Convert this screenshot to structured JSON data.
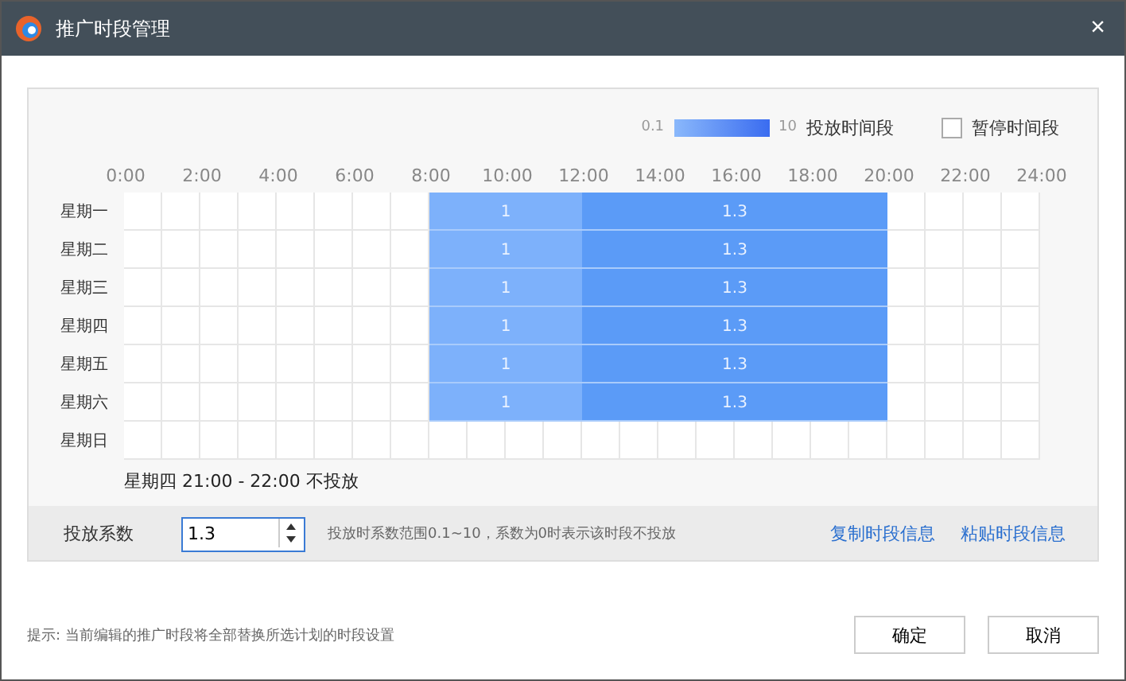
{
  "window": {
    "title": "推广时段管理",
    "close": "×"
  },
  "legend": {
    "min": "0.1",
    "max": "10",
    "label": "投放时间段",
    "pause": {
      "label": "暂停时间段",
      "checked": false
    }
  },
  "hours": [
    "0:00",
    "2:00",
    "4:00",
    "6:00",
    "8:00",
    "10:00",
    "12:00",
    "14:00",
    "16:00",
    "18:00",
    "20:00",
    "22:00",
    "24:00"
  ],
  "schedule": [
    {
      "day": "星期一",
      "values": [
        "1",
        "1.3"
      ],
      "cells": [
        {
          "active": false
        },
        {
          "active": false
        },
        {
          "active": false
        },
        {
          "active": false
        },
        {
          "active": false
        },
        {
          "active": false
        },
        {
          "active": false
        },
        {
          "active": false
        },
        {
          "active": true,
          "color": "#7db1fb"
        },
        {
          "active": true,
          "color": "#7db1fb"
        },
        {
          "active": true,
          "color": "#7db1fb"
        },
        {
          "active": true,
          "color": "#7db1fb"
        },
        {
          "active": true,
          "color": "#5b9bf7"
        },
        {
          "active": true,
          "color": "#5b9bf7"
        },
        {
          "active": true,
          "color": "#5b9bf7"
        },
        {
          "active": true,
          "color": "#5b9bf7"
        },
        {
          "active": true,
          "color": "#5b9bf7"
        },
        {
          "active": true,
          "color": "#5b9bf7"
        },
        {
          "active": true,
          "color": "#5b9bf7"
        },
        {
          "active": true,
          "color": "#5b9bf7"
        },
        {
          "active": false
        },
        {
          "active": false
        },
        {
          "active": false
        },
        {
          "active": false
        }
      ]
    },
    {
      "day": "星期二",
      "values": [
        "1",
        "1.3"
      ],
      "cells": [
        {
          "active": false
        },
        {
          "active": false
        },
        {
          "active": false
        },
        {
          "active": false
        },
        {
          "active": false
        },
        {
          "active": false
        },
        {
          "active": false
        },
        {
          "active": false
        },
        {
          "active": true,
          "color": "#7db1fb"
        },
        {
          "active": true,
          "color": "#7db1fb"
        },
        {
          "active": true,
          "color": "#7db1fb"
        },
        {
          "active": true,
          "color": "#7db1fb"
        },
        {
          "active": true,
          "color": "#5b9bf7"
        },
        {
          "active": true,
          "color": "#5b9bf7"
        },
        {
          "active": true,
          "color": "#5b9bf7"
        },
        {
          "active": true,
          "color": "#5b9bf7"
        },
        {
          "active": true,
          "color": "#5b9bf7"
        },
        {
          "active": true,
          "color": "#5b9bf7"
        },
        {
          "active": true,
          "color": "#5b9bf7"
        },
        {
          "active": true,
          "color": "#5b9bf7"
        },
        {
          "active": false
        },
        {
          "active": false
        },
        {
          "active": false
        },
        {
          "active": false
        }
      ]
    },
    {
      "day": "星期三",
      "values": [
        "1",
        "1.3"
      ],
      "cells": [
        {
          "active": false
        },
        {
          "active": false
        },
        {
          "active": false
        },
        {
          "active": false
        },
        {
          "active": false
        },
        {
          "active": false
        },
        {
          "active": false
        },
        {
          "active": false
        },
        {
          "active": true,
          "color": "#7db1fb"
        },
        {
          "active": true,
          "color": "#7db1fb"
        },
        {
          "active": true,
          "color": "#7db1fb"
        },
        {
          "active": true,
          "color": "#7db1fb"
        },
        {
          "active": true,
          "color": "#5b9bf7"
        },
        {
          "active": true,
          "color": "#5b9bf7"
        },
        {
          "active": true,
          "color": "#5b9bf7"
        },
        {
          "active": true,
          "color": "#5b9bf7"
        },
        {
          "active": true,
          "color": "#5b9bf7"
        },
        {
          "active": true,
          "color": "#5b9bf7"
        },
        {
          "active": true,
          "color": "#5b9bf7"
        },
        {
          "active": true,
          "color": "#5b9bf7"
        },
        {
          "active": false
        },
        {
          "active": false
        },
        {
          "active": false
        },
        {
          "active": false
        }
      ]
    },
    {
      "day": "星期四",
      "values": [
        "1",
        "1.3"
      ],
      "cells": [
        {
          "active": false
        },
        {
          "active": false
        },
        {
          "active": false
        },
        {
          "active": false
        },
        {
          "active": false
        },
        {
          "active": false
        },
        {
          "active": false
        },
        {
          "active": false
        },
        {
          "active": true,
          "color": "#7db1fb"
        },
        {
          "active": true,
          "color": "#7db1fb"
        },
        {
          "active": true,
          "color": "#7db1fb"
        },
        {
          "active": true,
          "color": "#7db1fb"
        },
        {
          "active": true,
          "color": "#5b9bf7"
        },
        {
          "active": true,
          "color": "#5b9bf7"
        },
        {
          "active": true,
          "color": "#5b9bf7"
        },
        {
          "active": true,
          "color": "#5b9bf7"
        },
        {
          "active": true,
          "color": "#5b9bf7"
        },
        {
          "active": true,
          "color": "#5b9bf7"
        },
        {
          "active": true,
          "color": "#5b9bf7"
        },
        {
          "active": true,
          "color": "#5b9bf7"
        },
        {
          "active": false
        },
        {
          "active": false
        },
        {
          "active": false
        },
        {
          "active": false
        }
      ]
    },
    {
      "day": "星期五",
      "values": [
        "1",
        "1.3"
      ],
      "cells": [
        {
          "active": false
        },
        {
          "active": false
        },
        {
          "active": false
        },
        {
          "active": false
        },
        {
          "active": false
        },
        {
          "active": false
        },
        {
          "active": false
        },
        {
          "active": false
        },
        {
          "active": true,
          "color": "#7db1fb"
        },
        {
          "active": true,
          "color": "#7db1fb"
        },
        {
          "active": true,
          "color": "#7db1fb"
        },
        {
          "active": true,
          "color": "#7db1fb"
        },
        {
          "active": true,
          "color": "#5b9bf7"
        },
        {
          "active": true,
          "color": "#5b9bf7"
        },
        {
          "active": true,
          "color": "#5b9bf7"
        },
        {
          "active": true,
          "color": "#5b9bf7"
        },
        {
          "active": true,
          "color": "#5b9bf7"
        },
        {
          "active": true,
          "color": "#5b9bf7"
        },
        {
          "active": true,
          "color": "#5b9bf7"
        },
        {
          "active": true,
          "color": "#5b9bf7"
        },
        {
          "active": false
        },
        {
          "active": false
        },
        {
          "active": false
        },
        {
          "active": false
        }
      ]
    },
    {
      "day": "星期六",
      "values": [
        "1",
        "1.3"
      ],
      "cells": [
        {
          "active": false
        },
        {
          "active": false
        },
        {
          "active": false
        },
        {
          "active": false
        },
        {
          "active": false
        },
        {
          "active": false
        },
        {
          "active": false
        },
        {
          "active": false
        },
        {
          "active": true,
          "color": "#7db1fb"
        },
        {
          "active": true,
          "color": "#7db1fb"
        },
        {
          "active": true,
          "color": "#7db1fb"
        },
        {
          "active": true,
          "color": "#7db1fb"
        },
        {
          "active": true,
          "color": "#5b9bf7"
        },
        {
          "active": true,
          "color": "#5b9bf7"
        },
        {
          "active": true,
          "color": "#5b9bf7"
        },
        {
          "active": true,
          "color": "#5b9bf7"
        },
        {
          "active": true,
          "color": "#5b9bf7"
        },
        {
          "active": true,
          "color": "#5b9bf7"
        },
        {
          "active": true,
          "color": "#5b9bf7"
        },
        {
          "active": true,
          "color": "#5b9bf7"
        },
        {
          "active": false
        },
        {
          "active": false
        },
        {
          "active": false
        },
        {
          "active": false
        }
      ]
    },
    {
      "day": "星期日",
      "cells": [
        {
          "active": false
        },
        {
          "active": false
        },
        {
          "active": false
        },
        {
          "active": false
        },
        {
          "active": false
        },
        {
          "active": false
        },
        {
          "active": false
        },
        {
          "active": false
        },
        {
          "active": false
        },
        {
          "active": false
        },
        {
          "active": false
        },
        {
          "active": false
        },
        {
          "active": false
        },
        {
          "active": false
        },
        {
          "active": false
        },
        {
          "active": false
        },
        {
          "active": false
        },
        {
          "active": false
        },
        {
          "active": false
        },
        {
          "active": false
        },
        {
          "active": false
        },
        {
          "active": false
        },
        {
          "active": false
        },
        {
          "active": false
        }
      ]
    }
  ],
  "status": "星期四 21:00 - 22:00 不投放",
  "coefficient": {
    "label": "投放系数",
    "value": "1.3",
    "hint": "投放时系数范围0.1~10，系数为0时表示该时段不投放",
    "links": [
      "复制时段信息",
      "粘贴时段信息"
    ]
  },
  "footer": {
    "tip": "提示: 当前编辑的推广时段将全部替换所选计划的时段设置",
    "buttons": [
      "确定",
      "取消"
    ]
  }
}
